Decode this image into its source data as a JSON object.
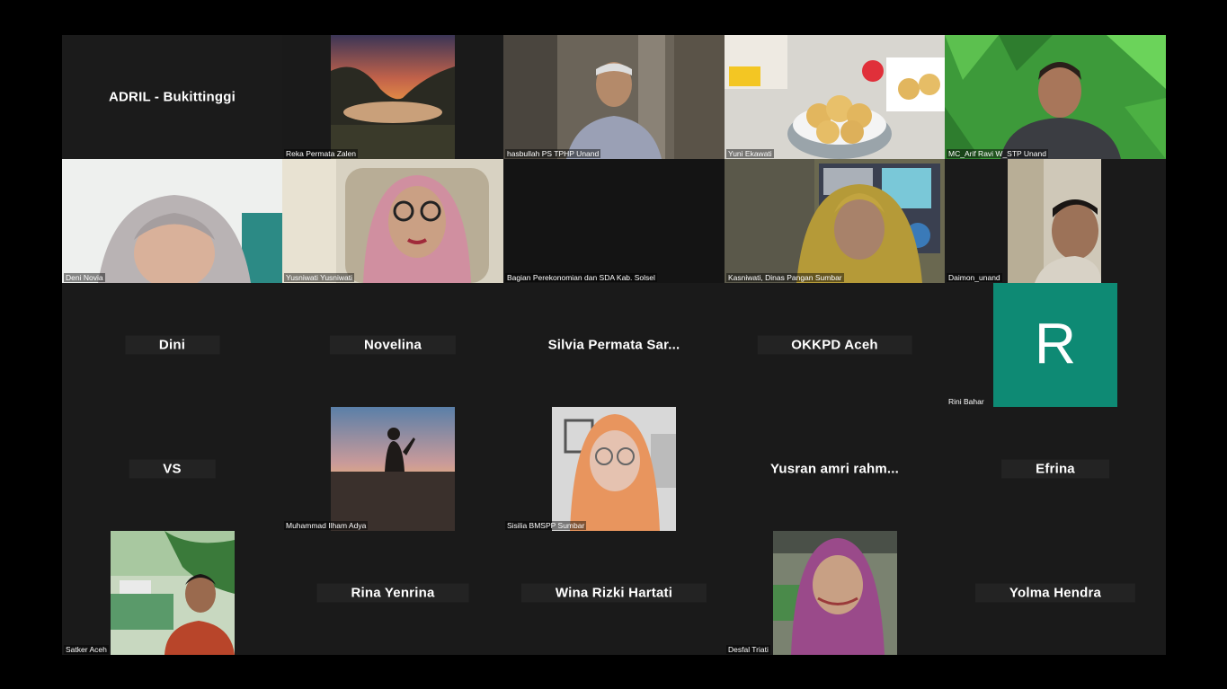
{
  "participants": [
    {
      "display": "ADRIL - Bukittinggi"
    },
    {
      "label": "Reka Permata Zalen"
    },
    {
      "label": "hasbullah PS TPHP Unand"
    },
    {
      "label": "Yuni Ekawati"
    },
    {
      "label": "MC_Arif Ravi W_STP Unand"
    },
    {
      "label": "Deni Novia"
    },
    {
      "label": "Yusniwati Yusniwati"
    },
    {
      "label": "Bagian Perekonomian dan SDA Kab. Solsel"
    },
    {
      "label": "Kasniwati, Dinas Pangan Sumbar"
    },
    {
      "label": "Daimon_unand"
    },
    {
      "display": "Dini"
    },
    {
      "display": "Novelina"
    },
    {
      "display": "Silvia Permata Sar..."
    },
    {
      "display": "OKKPD Aceh"
    },
    {
      "label": "Rini Bahar",
      "avatar_letter": "R",
      "avatar_color": "#0e8a74"
    },
    {
      "display": "VS"
    },
    {
      "label": "Muhammad Ilham Adya"
    },
    {
      "label": "Sisilia BMSPP Sumbar"
    },
    {
      "display": "Yusran amri rahm..."
    },
    {
      "display": "Efrina"
    },
    {
      "label": "Satker Aceh"
    },
    {
      "display": "Rina Yenrina"
    },
    {
      "display": "Wina Rizki Hartati"
    },
    {
      "label": "Desfal Triati"
    },
    {
      "display": "Yolma Hendra"
    }
  ]
}
